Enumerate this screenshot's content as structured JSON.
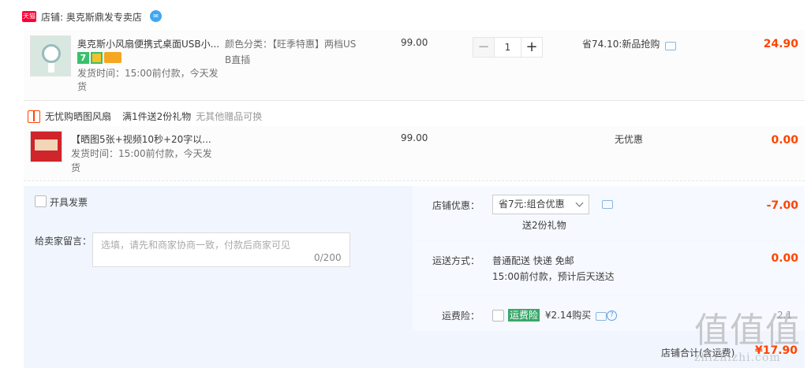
{
  "shop": {
    "tag": "天猫",
    "label": "店铺: 奥克斯鼎发专卖店",
    "ww_icon": "wangwang-icon"
  },
  "items": [
    {
      "title": "奥克斯小风扇便携式桌面USB小...",
      "ship_line1": "发货时间：15:00前付款，今天发",
      "ship_line2": "货",
      "sku_line1": "颜色分类：【旺季特惠】两档US",
      "sku_line2": "B直插",
      "unit_price": "99.00",
      "quantity": "1",
      "discount": "省74.10:新品抢购",
      "total": "24.90"
    },
    {
      "title": "【晒图5张+视频10秒+20字以...",
      "ship_line1": "发货时间：15:00前付款，今天发",
      "ship_line2": "货",
      "unit_price": "99.00",
      "discount": "无优惠",
      "total": "0.00"
    }
  ],
  "gift": {
    "name": "无忧购晒图风扇",
    "promo": "满1件送2份礼物",
    "note": "无其他赠品可换"
  },
  "invoice": {
    "label": "开具发票"
  },
  "message": {
    "label": "给卖家留言：",
    "placeholder": "选填，请先和商家协商一致，付款后商家可见",
    "counter": "0/200"
  },
  "shop_discount": {
    "label": "店铺优惠：",
    "selected": "省7元:组合优惠",
    "sub": "送2份礼物",
    "amount": "-7.00"
  },
  "shipping": {
    "label": "运送方式：",
    "method": "普通配送 快递 免邮",
    "eta": "15:00前付款，预计后天送达",
    "amount": "0.00"
  },
  "insurance": {
    "label": "运费险：",
    "tag": "运费险",
    "price": "¥2.14购买",
    "amount_partial": "2.1"
  },
  "summary": {
    "label": "店铺合计(含运费)",
    "amount": "¥17.90"
  },
  "watermark": {
    "glyphs": "值值值",
    "domain": "zhizhizhi.com"
  }
}
